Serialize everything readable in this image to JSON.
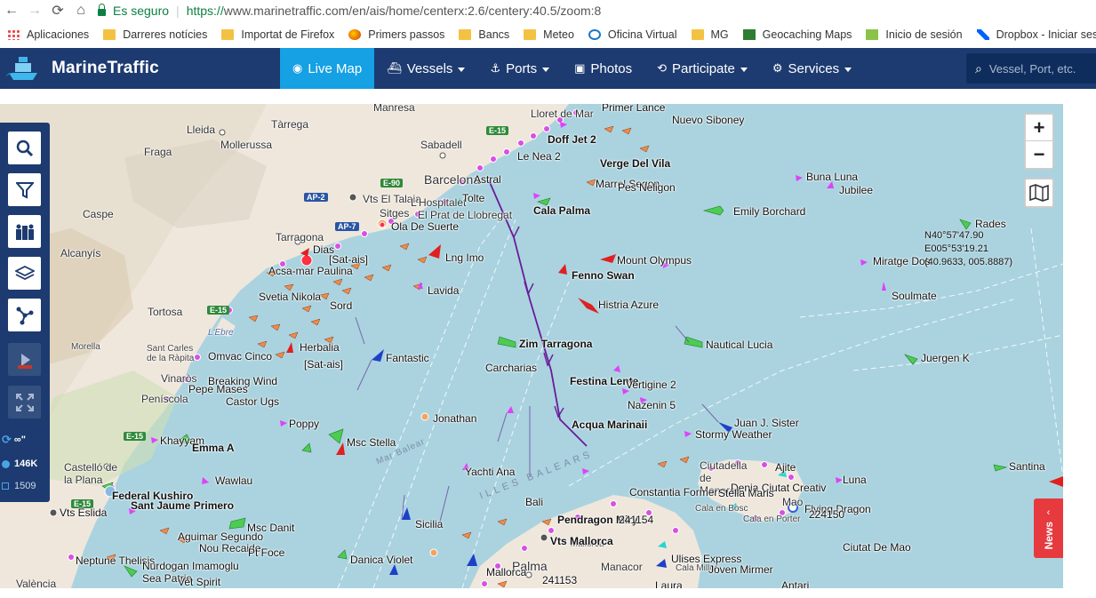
{
  "browser": {
    "secure_label": "Es seguro",
    "url_scheme": "https://",
    "url_rest": "www.marinetraffic.com/en/ais/home/centerx:2.6/centery:40.5/zoom:8",
    "bookmarks": [
      "Aplicaciones",
      "Darreres notícies",
      "Importat de Firefox",
      "Primers passos",
      "Bancs",
      "Meteo",
      "Oficina Virtual",
      "MG",
      "Geocaching Maps",
      "Inicio de sesión",
      "Dropbox - Iniciar sesi"
    ]
  },
  "site": {
    "logo_text": "MarineTraffic",
    "nav": [
      "Live Map",
      "Vessels",
      "Ports",
      "Photos",
      "Participate",
      "Services"
    ],
    "search_placeholder": "Vessel, Port, etc."
  },
  "map": {
    "coords": [
      "N40°57'47.90",
      "E005°53'19.21",
      "(40.9633, 005.8887)"
    ],
    "zoom_in": "+",
    "zoom_out": "−",
    "news_label": "News",
    "stats": {
      "infinity": "∞\"",
      "vessels": "146K",
      "other": "1509"
    },
    "places": [
      "Manresa",
      "Lleida",
      "Tàrrega",
      "Sabadell",
      "Mollerussa",
      "Fraga",
      "Caspe",
      "Alcanyís",
      "Tarragona",
      "Tortosa",
      "Morella",
      "Vinaròs",
      "Peníscola",
      "Castelló de la Plana",
      "València",
      "Sitges",
      "Vts El Talaia",
      "L'Hospitalet",
      "El Prat de Llobregat",
      "Mallorca",
      "Palma",
      "Manacor",
      "Ciutadella de Menorca",
      "Cala Millor",
      "Cala en Porter",
      "Cala en Bosc",
      "Mao",
      "Sant Carles de la Ràpita",
      "L'Ebre"
    ],
    "vessels": [
      "Primer Lance",
      "Lloret de Mar",
      "Nuevo Siboney",
      "Doff Jet 2",
      "Le Nea 2",
      "Verge Del Vila",
      "Marrel Segon",
      "Pes Neligon",
      "Buna Luna",
      "Jubilee",
      "Barcelona",
      "Astral",
      "Tolte",
      "Cala Palma",
      "Emily Borchard",
      "Rades",
      "Ola De Suerte",
      "Lng Imo",
      "Mount Olympus",
      "Miratge Dos",
      "Dias",
      "[Sat-ais]",
      "Acsa-mar Paulina",
      "Fenno Swan",
      "Soulmate",
      "Lavida",
      "Svetia Nikola",
      "Sord",
      "Histria Azure",
      "Zim Tarragona",
      "Nautical Lucia",
      "Herbalia",
      "[Sat-ais]",
      "Fantastic",
      "Juergen K",
      "Omvac Cinco",
      "Carcharias",
      "Breaking Wind",
      "Festina Lente",
      "Vertigine 2",
      "Pepe Mases",
      "Castor Ugs",
      "Nazenin 5",
      "Poppy",
      "Jonathan",
      "Acqua Marinaii",
      "Juan J. Sister",
      "Stormy Weather",
      "Khayyam",
      "Emma A",
      "Msc Stella",
      "Yachti Ana",
      "Ajite",
      "Santina",
      "Wawlau",
      "Denia Ciutat Creativ",
      "Luna",
      "Federal Kushiro",
      "Constantia Former",
      "Stella Maris",
      "Sant Jaume Primero",
      "Bali",
      "Pendragon Miry",
      "241154",
      "Flying Dragon",
      "224150",
      "Vts Eslida",
      "Sicilia",
      "Msc Danit",
      "Aguimar Segundo",
      "Nou Recaide",
      "Pt Foce",
      "Vts Mallorca",
      "Ciutat De Mao",
      "Neptune Thelisis",
      "Danica Violet",
      "Nurdogan Imamoglu",
      "Sea Patrie",
      "Vet Spirit",
      "Mallorca",
      "241153",
      "Ulises Express",
      "Joven Mirmer",
      "Laura",
      "Antari"
    ],
    "sea_labels": [
      "ILLES BALEARS",
      "Mar Balear"
    ],
    "roads": [
      "E-15",
      "AP-2",
      "E-90",
      "AP-7",
      "E-15",
      "E-15",
      "E-15"
    ]
  }
}
